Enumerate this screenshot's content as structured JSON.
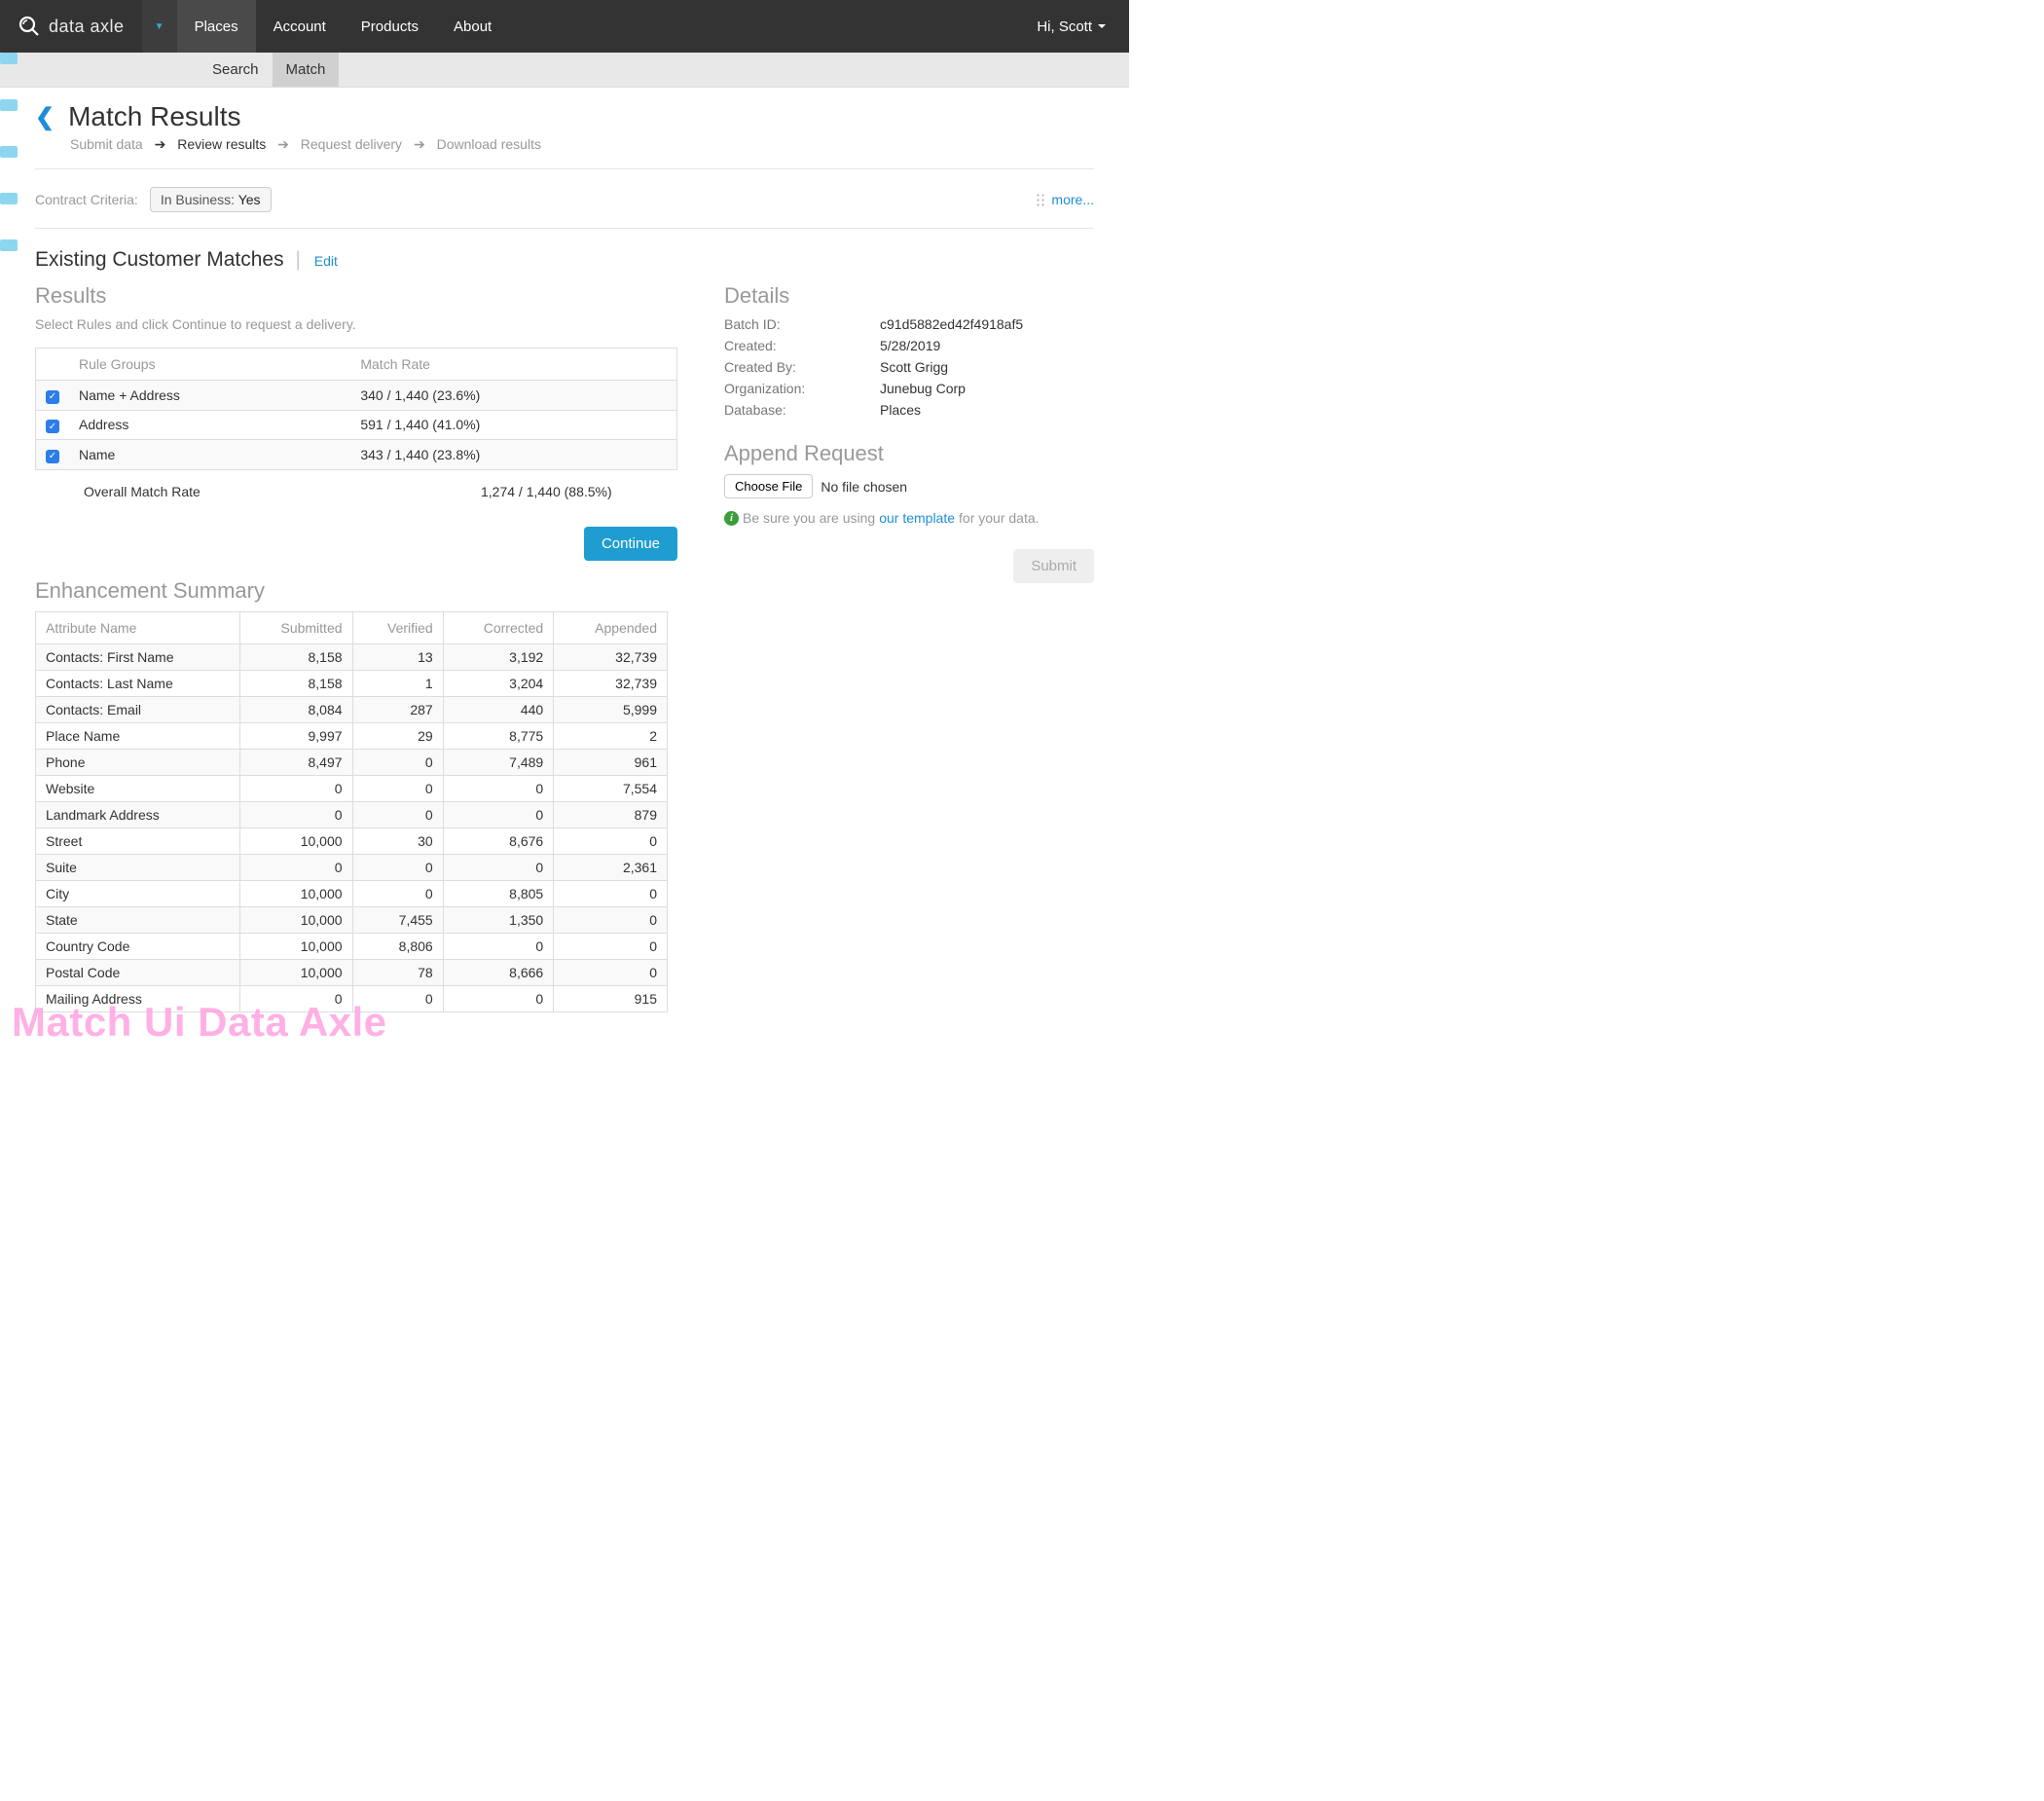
{
  "brand": "data axle",
  "nav": {
    "items": [
      "Places",
      "Account",
      "Products",
      "About"
    ],
    "user_greeting": "Hi, Scott"
  },
  "subnav": {
    "items": [
      "Search",
      "Match"
    ]
  },
  "page": {
    "title": "Match Results",
    "breadcrumbs": [
      "Submit data",
      "Review results",
      "Request delivery",
      "Download results"
    ]
  },
  "criteria": {
    "label": "Contract Criteria:",
    "chip_key": "In Business: ",
    "chip_val": "Yes",
    "more": "more..."
  },
  "matches": {
    "heading": "Existing Customer Matches",
    "edit": "Edit"
  },
  "results": {
    "heading": "Results",
    "hint": "Select Rules and click Continue to request a delivery.",
    "col_rule": "Rule Groups",
    "col_rate": "Match Rate",
    "rows": [
      {
        "rule": "Name + Address",
        "rate": "340 / 1,440 (23.6%)"
      },
      {
        "rule": "Address",
        "rate": "591 / 1,440 (41.0%)"
      },
      {
        "rule": "Name",
        "rate": "343 / 1,440 (23.8%)"
      }
    ],
    "overall_label": "Overall Match Rate",
    "overall_value": "1,274 / 1,440 (88.5%)",
    "continue": "Continue"
  },
  "enhancement": {
    "heading": "Enhancement Summary",
    "cols": [
      "Attribute Name",
      "Submitted",
      "Verified",
      "Corrected",
      "Appended"
    ],
    "rows": [
      {
        "name": "Contacts: First Name",
        "submitted": "8,158",
        "verified": "13",
        "corrected": "3,192",
        "appended": "32,739"
      },
      {
        "name": "Contacts: Last Name",
        "submitted": "8,158",
        "verified": "1",
        "corrected": "3,204",
        "appended": "32,739"
      },
      {
        "name": "Contacts: Email",
        "submitted": "8,084",
        "verified": "287",
        "corrected": "440",
        "appended": "5,999"
      },
      {
        "name": "Place Name",
        "submitted": "9,997",
        "verified": "29",
        "corrected": "8,775",
        "appended": "2"
      },
      {
        "name": "Phone",
        "submitted": "8,497",
        "verified": "0",
        "corrected": "7,489",
        "appended": "961"
      },
      {
        "name": "Website",
        "submitted": "0",
        "verified": "0",
        "corrected": "0",
        "appended": "7,554"
      },
      {
        "name": "Landmark Address",
        "submitted": "0",
        "verified": "0",
        "corrected": "0",
        "appended": "879"
      },
      {
        "name": "Street",
        "submitted": "10,000",
        "verified": "30",
        "corrected": "8,676",
        "appended": "0"
      },
      {
        "name": "Suite",
        "submitted": "0",
        "verified": "0",
        "corrected": "0",
        "appended": "2,361"
      },
      {
        "name": "City",
        "submitted": "10,000",
        "verified": "0",
        "corrected": "8,805",
        "appended": "0"
      },
      {
        "name": "State",
        "submitted": "10,000",
        "verified": "7,455",
        "corrected": "1,350",
        "appended": "0"
      },
      {
        "name": "Country Code",
        "submitted": "10,000",
        "verified": "8,806",
        "corrected": "0",
        "appended": "0"
      },
      {
        "name": "Postal Code",
        "submitted": "10,000",
        "verified": "78",
        "corrected": "8,666",
        "appended": "0"
      },
      {
        "name": "Mailing Address",
        "submitted": "0",
        "verified": "0",
        "corrected": "0",
        "appended": "915"
      }
    ]
  },
  "details": {
    "heading": "Details",
    "batch_id_k": "Batch ID:",
    "batch_id_v": "c91d5882ed42f4918af5",
    "created_k": "Created:",
    "created_v": "5/28/2019",
    "created_by_k": "Created By:",
    "created_by_v": "Scott Grigg",
    "org_k": "Organization:",
    "org_v": "Junebug Corp",
    "db_k": "Database:",
    "db_v": "Places"
  },
  "append": {
    "heading": "Append Request",
    "choose_file": "Choose File",
    "no_file": "No file chosen",
    "info_prefix": "Be sure you are using ",
    "info_link": "our template",
    "info_suffix": " for your data.",
    "submit": "Submit"
  },
  "watermark": "Match Ui Data Axle"
}
